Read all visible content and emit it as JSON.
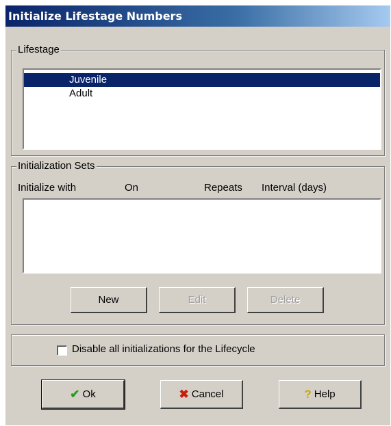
{
  "window": {
    "title": "Initialize Lifestage Numbers"
  },
  "lifestage": {
    "group_label": "Lifestage",
    "items": [
      {
        "label": "Juvenile",
        "selected": true
      },
      {
        "label": "Adult",
        "selected": false
      }
    ]
  },
  "initialization_sets": {
    "group_label": "Initialization Sets",
    "columns": [
      "Initialize with",
      "On",
      "Repeats",
      "Interval (days)"
    ],
    "rows": [],
    "buttons": {
      "new": "New",
      "edit": "Edit",
      "delete": "Delete"
    }
  },
  "disable_option": {
    "label": "Disable all initializations for the Lifecycle",
    "checked": false
  },
  "footer": {
    "ok": "Ok",
    "cancel": "Cancel",
    "help": "Help"
  },
  "icons": {
    "ok": "checkmark-icon",
    "cancel": "x-icon",
    "help": "question-icon"
  },
  "colors": {
    "selection": "#0a246a",
    "ok_icon": "#2e9a1e",
    "cancel_icon": "#c81e0a",
    "help_icon": "#c8a800"
  }
}
